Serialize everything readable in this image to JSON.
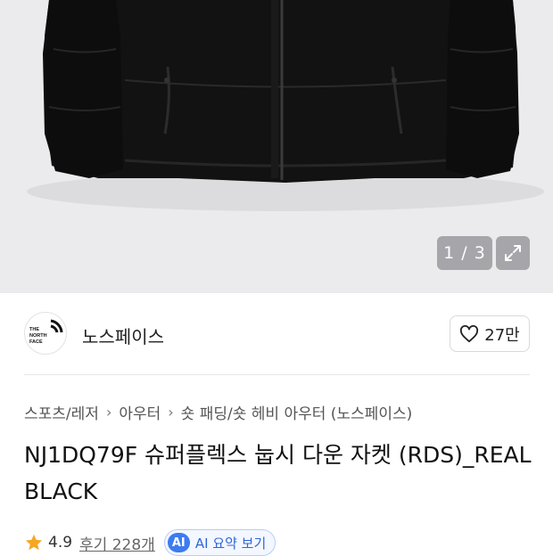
{
  "gallery": {
    "counter": "1 / 3"
  },
  "brand": {
    "logo_text": "THE NORTH FACE",
    "name": "노스페이스",
    "like_count": "27만"
  },
  "breadcrumb": [
    "스포츠/레저",
    "아우터",
    "숏 패딩/숏 헤비 아우터 (노스페이스)"
  ],
  "product": {
    "title": "NJ1DQ79F 슈퍼플렉스 눕시 다운 자켓 (RDS)_REAL BLACK",
    "rating": "4.9",
    "reviews": "후기 228개",
    "ai_summary": "AI 요약 보기",
    "ai_badge": "AI"
  },
  "colors": {
    "star": "#f5a623",
    "ai_blue": "#3d7bf0",
    "hero_bg": "#ebebed"
  }
}
